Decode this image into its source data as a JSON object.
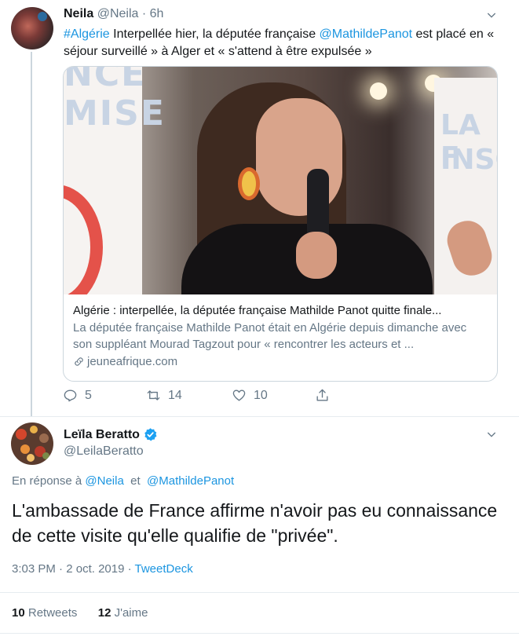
{
  "parent_tweet": {
    "author_name": "Neila",
    "author_handle": "@Neila",
    "separator": "·",
    "time": "6h",
    "text_hashtag": "#Algérie",
    "text_part1": " Interpellée hier, la députée française ",
    "text_mention": "@MathildePanot",
    "text_part2": " est placé en « séjour surveillé » à Alger et « s'attend à être expulsée »",
    "card": {
      "image_banner_left_lines": [
        "NCE",
        "MISE"
      ],
      "image_banner_right_lines": [
        "LA F",
        "INSO"
      ],
      "title": "Algérie : interpellée, la députée française Mathilde Panot quitte finale...",
      "description": "La députée française Mathilde Panot était en Algérie depuis dimanche avec son suppléant Mourad Tagzout pour « rencontrer les acteurs et ...",
      "domain": "jeuneafrique.com"
    },
    "actions": {
      "reply_count": "5",
      "retweet_count": "14",
      "like_count": "10"
    }
  },
  "main_tweet": {
    "author_name": "Leïla Beratto",
    "author_handle": "@LeilaBeratto",
    "reply_prefix": "En réponse à ",
    "reply_mention1": "@Neila",
    "reply_joiner": "  et  ",
    "reply_mention2": "@MathildePanot",
    "text": "L'ambassade de France affirme n'avoir pas eu connaissance de cette visite qu'elle qualifie de \"privée\".",
    "time": "3:03 PM",
    "date_sep": " · ",
    "date": "2 oct. 2019",
    "source_sep": " · ",
    "source": "TweetDeck",
    "retweets_count": "10",
    "retweets_label": "Retweets",
    "likes_count": "12",
    "likes_label": "J'aime"
  },
  "colors": {
    "link": "#1b95e0",
    "secondary_text": "#657786",
    "primary_text": "#14171a",
    "verified": "#1da1f2"
  }
}
